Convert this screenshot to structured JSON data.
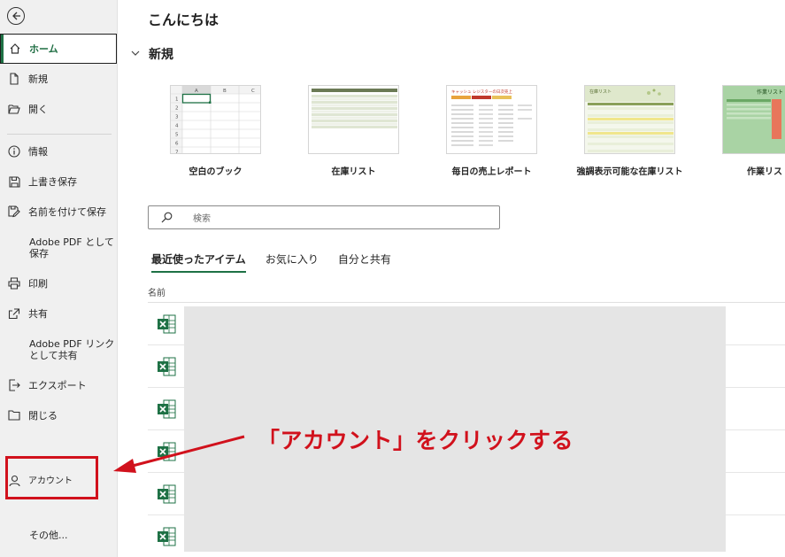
{
  "sidebar": {
    "back_label": "",
    "items": [
      {
        "label": "ホーム",
        "icon": "home-icon"
      },
      {
        "label": "新規",
        "icon": "new-file-icon"
      },
      {
        "label": "開く",
        "icon": "open-folder-icon"
      },
      {
        "label": "情報",
        "icon": "info-icon"
      },
      {
        "label": "上書き保存",
        "icon": "save-icon"
      },
      {
        "label": "名前を付けて保存",
        "icon": "save-as-icon"
      },
      {
        "label": "Adobe PDF として\n保存",
        "icon": ""
      },
      {
        "label": "印刷",
        "icon": "print-icon"
      },
      {
        "label": "共有",
        "icon": "share-icon"
      },
      {
        "label": "Adobe PDF リンク\nとして共有",
        "icon": ""
      },
      {
        "label": "エクスポート",
        "icon": "export-icon"
      },
      {
        "label": "閉じる",
        "icon": "close-folder-icon"
      },
      {
        "label": "アカウント",
        "icon": "account-icon"
      },
      {
        "label": "その他...",
        "icon": ""
      }
    ]
  },
  "main": {
    "greeting": "こんにちは",
    "new_section": "新規",
    "templates": [
      {
        "name": "空白のブック",
        "columns": [
          "A",
          "B",
          "C"
        ],
        "rows": [
          "1",
          "2",
          "3",
          "4",
          "5",
          "6",
          "7"
        ]
      },
      {
        "name": "在庫リスト"
      },
      {
        "name": "毎日の売上レポート",
        "thumb_title": "キャッシュ レジスターの日次売上"
      },
      {
        "name": "強調表示可能な在庫リスト",
        "thumb_title": "在庫リスト"
      },
      {
        "name": "作業リスト",
        "thumb_title": "作業リスト"
      }
    ],
    "search_placeholder": "検索",
    "tabs": [
      "最近使ったアイテム",
      "お気に入り",
      "自分と共有"
    ],
    "column_header": "名前",
    "file_count": 6
  },
  "annotation": {
    "text": "「アカウント」をクリックする"
  },
  "colors": {
    "excel_green": "#1e7145",
    "highlight_red": "#d1111c"
  }
}
